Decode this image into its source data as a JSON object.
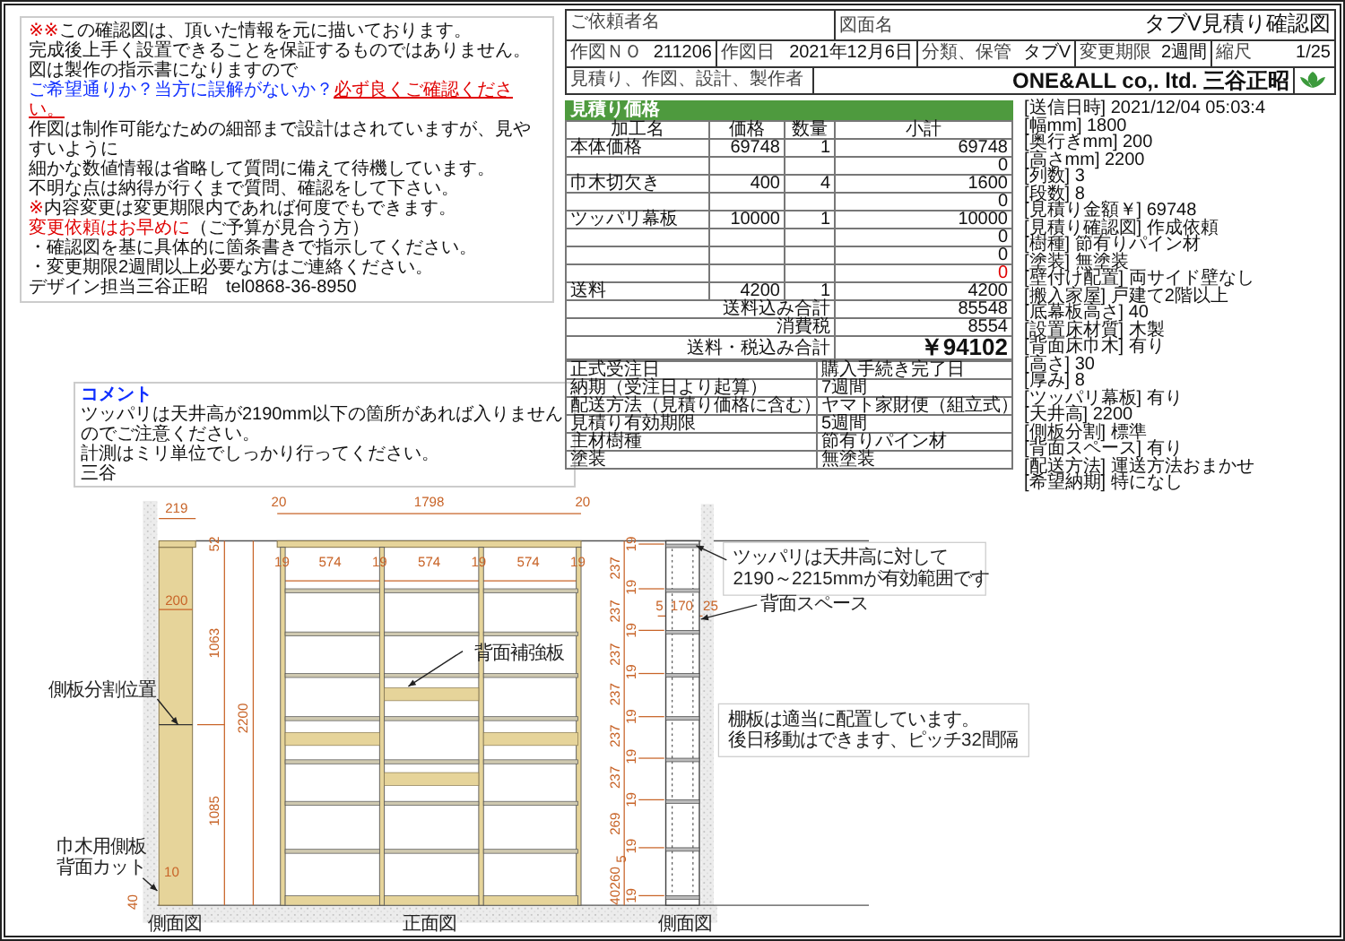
{
  "notice": {
    "lines": [
      {
        "segments": [
          {
            "text": "※※",
            "kind": "alert"
          },
          {
            "text": "この確認図は、頂いた情報を元に描いております。",
            "kind": "plain"
          }
        ]
      },
      {
        "segments": [
          {
            "text": "完成後上手く設置できることを保証するものではありません。",
            "kind": "plain"
          }
        ]
      },
      {
        "segments": [
          {
            "text": "図は製作の指示書になりますので",
            "kind": "plain"
          }
        ]
      },
      {
        "segments": [
          {
            "text": "ご希望通りか？当方に誤解がないか？",
            "kind": "info"
          },
          {
            "text": "必ず良くご確認ください。",
            "kind": "warning"
          }
        ]
      },
      {
        "segments": [
          {
            "text": "作図は制作可能なための細部まで設計はされていますが、見やすいように",
            "kind": "plain"
          }
        ]
      },
      {
        "segments": [
          {
            "text": "細かな数値情報は省略して質問に備えて待機しています。",
            "kind": "plain"
          }
        ]
      },
      {
        "segments": [
          {
            "text": "不明な点は納得が行くまで質問、確認をして下さい。",
            "kind": "plain"
          }
        ]
      },
      {
        "segments": [
          {
            "text": "※",
            "kind": "alert"
          },
          {
            "text": "内容変更は変更期限内であれば何度でもできます。",
            "kind": "plain"
          }
        ]
      },
      {
        "segments": [
          {
            "text": "変更依頼はお早めに",
            "kind": "alert"
          },
          {
            "text": "（ご予算が見合う方）",
            "kind": "plain"
          }
        ]
      },
      {
        "segments": [
          {
            "text": "・確認図を基に具体的に箇条書きで指示してください。",
            "kind": "plain"
          }
        ]
      },
      {
        "segments": [
          {
            "text": "・変更期限2週間以上必要な方はご連絡ください。",
            "kind": "plain"
          }
        ]
      },
      {
        "segments": [
          {
            "text": "デザイン担当三谷正昭　tel0868-36-8950",
            "kind": "plain"
          }
        ]
      }
    ]
  },
  "comment": {
    "title": "コメント",
    "lines": [
      "ツッパリは天井高が2190mm以下の箇所があれば入りませんのでご注意ください。",
      "計測はミリ単位でしっかり行ってください。",
      "三谷"
    ]
  },
  "title_block": {
    "client": {
      "label": "ご依頼者名"
    },
    "drawing": {
      "label": "図面名",
      "value": "タブV見積り確認図"
    },
    "fields": [
      {
        "label": "作図ＮＯ",
        "value": "211206"
      },
      {
        "label": "作図日",
        "value": "2021年12月6日"
      },
      {
        "label": "分類、保管",
        "value": "タブV"
      },
      {
        "label": "変更期限",
        "value": "2週間"
      },
      {
        "label": "縮尺",
        "value": "1/25"
      }
    ],
    "maker": {
      "label": "見積り、作図、設計、製作者",
      "value": "ONE&ALL co,. ltd. 三谷正昭"
    }
  },
  "estimate": {
    "title": "見積り価格",
    "columns": [
      "加工名",
      "価格",
      "数量",
      "小計"
    ],
    "items": [
      {
        "name": "本体価格",
        "price": "69748",
        "qty": "1",
        "subtotal": "69748",
        "alert": false
      },
      {
        "subtotal": "0",
        "alert": false
      },
      {
        "name": "巾木切欠き",
        "price": "400",
        "qty": "4",
        "subtotal": "1600",
        "alert": false
      },
      {
        "subtotal": "0",
        "alert": false
      },
      {
        "name": "ツッパリ幕板",
        "price": "10000",
        "qty": "1",
        "subtotal": "10000",
        "alert": false
      },
      {
        "subtotal": "0",
        "alert": false
      },
      {
        "subtotal": "0",
        "alert": false
      },
      {
        "subtotal": "0",
        "alert": true
      },
      {
        "name": "送料",
        "price": "4200",
        "qty": "1",
        "subtotal": "4200",
        "alert": false
      }
    ],
    "totals": [
      {
        "label": "送料込み合計",
        "value": "85548",
        "kind": "sum"
      },
      {
        "label": "消費税",
        "value": "8554",
        "kind": "sum"
      },
      {
        "label": "送料・税込み合計",
        "value": "￥94102",
        "kind": "grand"
      }
    ],
    "terms": [
      {
        "label": "正式受注日",
        "value": "購入手続き完了日"
      },
      {
        "label": "納期（受注日より起算）",
        "value": "7週間"
      },
      {
        "label": "配送方法（見積り価格に含む）",
        "value": "ヤマト家財便（組立式）"
      },
      {
        "label": "見積り有効期限",
        "value": "5週間"
      },
      {
        "label": "主材樹種",
        "value": "節有りパイン材"
      },
      {
        "label": "塗装",
        "value": "無塗装"
      }
    ]
  },
  "specs": [
    "[送信日時] 2021/12/04 05:03:4",
    "[幅mm] 1800",
    "[奥行きmm] 200",
    "[高さmm] 2200",
    "[列数] 3",
    "[段数] 8",
    "[見積り金額￥] 69748",
    "[見積り確認図] 作成依頼",
    "[樹種] 節有りパイン材",
    "[塗装] 無塗装",
    "[壁付け配置] 両サイド壁なし",
    "[搬入家屋] 戸建て2階以上",
    "[底幕板高さ] 40",
    "[設置床材質] 木製",
    "[背面床巾木] 有り",
    "[高さ] 30",
    "[厚み] 8",
    "[ツッパリ幕板] 有り",
    "[天井高] 2200",
    "[側板分割] 標準",
    "[背面スペース] 有り",
    "[配送方法] 運送方法おまかせ",
    "[希望納期] 特になし"
  ],
  "drawing": {
    "side_view": {
      "caption": "側面図",
      "dims": [
        "219",
        "52",
        "200",
        "1063",
        "2200",
        "1085",
        "10",
        "40"
      ],
      "notes": [
        {
          "lines": [
            "側板分割位置"
          ]
        },
        {
          "lines": [
            "巾木用側板",
            "背面カット"
          ]
        }
      ]
    },
    "front_view": {
      "caption": "正面図",
      "top_dims": [
        "20",
        "1798",
        "20"
      ],
      "column_dims": [
        "19",
        "574",
        "19",
        "574",
        "19",
        "574",
        "19"
      ],
      "note": "背面補強板"
    },
    "side_view_2": {
      "caption": "側面図",
      "height_dims": [
        "19",
        "237",
        "19",
        "237",
        "19",
        "237",
        "19",
        "237",
        "19",
        "237",
        "19",
        "237",
        "19",
        "269",
        "19",
        "5",
        "260",
        "40",
        "19"
      ],
      "depth_dims": [
        "5",
        "170",
        "25"
      ],
      "notes": [
        {
          "lines": [
            "ツッパリは天井高に対して",
            "2190～2215mmが有効範囲です"
          ],
          "boxed": true
        },
        {
          "lines": [
            "背面スペース"
          ],
          "boxed": false
        },
        {
          "lines": [
            "棚板は適当に配置しています。",
            "後日移動はできます、ピッチ32間隔"
          ],
          "boxed": true
        }
      ]
    }
  }
}
